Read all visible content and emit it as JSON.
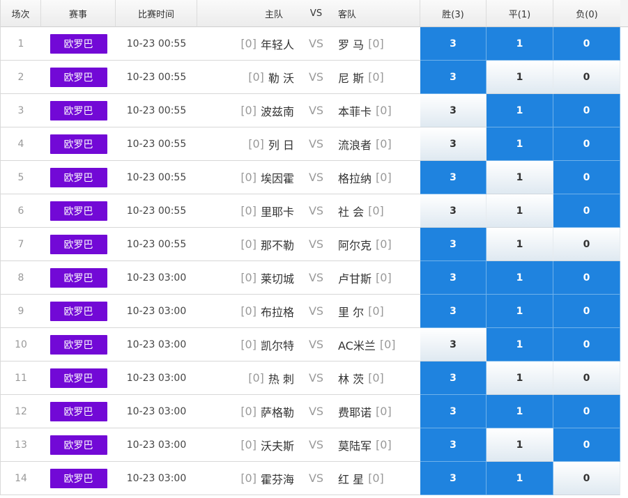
{
  "header": {
    "idx": "场次",
    "league": "赛事",
    "time": "比赛时间",
    "home": "主队",
    "vs": "VS",
    "away": "客队",
    "win": "胜(3)",
    "draw": "平(1)",
    "lose": "负(0)"
  },
  "colors": {
    "league_badge": "#7209d6",
    "selected": "#1f83df"
  },
  "matches": [
    {
      "idx": "1",
      "league": "欧罗巴",
      "time": "10-23 00:55",
      "home_rank": "[0]",
      "home": "年轻人",
      "vs": "VS",
      "away": "罗 马",
      "away_rank": "[0]",
      "win": "3",
      "draw": "1",
      "lose": "0",
      "sel_win": true,
      "sel_draw": true,
      "sel_lose": true
    },
    {
      "idx": "2",
      "league": "欧罗巴",
      "time": "10-23 00:55",
      "home_rank": "[0]",
      "home": "勒 沃",
      "vs": "VS",
      "away": "尼 斯",
      "away_rank": "[0]",
      "win": "3",
      "draw": "1",
      "lose": "0",
      "sel_win": true,
      "sel_draw": false,
      "sel_lose": false
    },
    {
      "idx": "3",
      "league": "欧罗巴",
      "time": "10-23 00:55",
      "home_rank": "[0]",
      "home": "波兹南",
      "vs": "VS",
      "away": "本菲卡",
      "away_rank": "[0]",
      "win": "3",
      "draw": "1",
      "lose": "0",
      "sel_win": false,
      "sel_draw": true,
      "sel_lose": true
    },
    {
      "idx": "4",
      "league": "欧罗巴",
      "time": "10-23 00:55",
      "home_rank": "[0]",
      "home": "列 日",
      "vs": "VS",
      "away": "流浪者",
      "away_rank": "[0]",
      "win": "3",
      "draw": "1",
      "lose": "0",
      "sel_win": false,
      "sel_draw": true,
      "sel_lose": true
    },
    {
      "idx": "5",
      "league": "欧罗巴",
      "time": "10-23 00:55",
      "home_rank": "[0]",
      "home": "埃因霍",
      "vs": "VS",
      "away": "格拉纳",
      "away_rank": "[0]",
      "win": "3",
      "draw": "1",
      "lose": "0",
      "sel_win": true,
      "sel_draw": false,
      "sel_lose": true
    },
    {
      "idx": "6",
      "league": "欧罗巴",
      "time": "10-23 00:55",
      "home_rank": "[0]",
      "home": "里耶卡",
      "vs": "VS",
      "away": "社 会",
      "away_rank": "[0]",
      "win": "3",
      "draw": "1",
      "lose": "0",
      "sel_win": false,
      "sel_draw": false,
      "sel_lose": true
    },
    {
      "idx": "7",
      "league": "欧罗巴",
      "time": "10-23 00:55",
      "home_rank": "[0]",
      "home": "那不勒",
      "vs": "VS",
      "away": "阿尔克",
      "away_rank": "[0]",
      "win": "3",
      "draw": "1",
      "lose": "0",
      "sel_win": true,
      "sel_draw": false,
      "sel_lose": false
    },
    {
      "idx": "8",
      "league": "欧罗巴",
      "time": "10-23 03:00",
      "home_rank": "[0]",
      "home": "莱切城",
      "vs": "VS",
      "away": "卢甘斯",
      "away_rank": "[0]",
      "win": "3",
      "draw": "1",
      "lose": "0",
      "sel_win": true,
      "sel_draw": true,
      "sel_lose": true
    },
    {
      "idx": "9",
      "league": "欧罗巴",
      "time": "10-23 03:00",
      "home_rank": "[0]",
      "home": "布拉格",
      "vs": "VS",
      "away": "里 尔",
      "away_rank": "[0]",
      "win": "3",
      "draw": "1",
      "lose": "0",
      "sel_win": true,
      "sel_draw": true,
      "sel_lose": true
    },
    {
      "idx": "10",
      "league": "欧罗巴",
      "time": "10-23 03:00",
      "home_rank": "[0]",
      "home": "凯尔特",
      "vs": "VS",
      "away": "AC米兰",
      "away_rank": "[0]",
      "win": "3",
      "draw": "1",
      "lose": "0",
      "sel_win": false,
      "sel_draw": true,
      "sel_lose": true
    },
    {
      "idx": "11",
      "league": "欧罗巴",
      "time": "10-23 03:00",
      "home_rank": "[0]",
      "home": "热 刺",
      "vs": "VS",
      "away": "林 茨",
      "away_rank": "[0]",
      "win": "3",
      "draw": "1",
      "lose": "0",
      "sel_win": true,
      "sel_draw": false,
      "sel_lose": false
    },
    {
      "idx": "12",
      "league": "欧罗巴",
      "time": "10-23 03:00",
      "home_rank": "[0]",
      "home": "萨格勒",
      "vs": "VS",
      "away": "费耶诺",
      "away_rank": "[0]",
      "win": "3",
      "draw": "1",
      "lose": "0",
      "sel_win": true,
      "sel_draw": true,
      "sel_lose": true
    },
    {
      "idx": "13",
      "league": "欧罗巴",
      "time": "10-23 03:00",
      "home_rank": "[0]",
      "home": "沃夫斯",
      "vs": "VS",
      "away": "莫陆军",
      "away_rank": "[0]",
      "win": "3",
      "draw": "1",
      "lose": "0",
      "sel_win": true,
      "sel_draw": false,
      "sel_lose": true
    },
    {
      "idx": "14",
      "league": "欧罗巴",
      "time": "10-23 03:00",
      "home_rank": "[0]",
      "home": "霍芬海",
      "vs": "VS",
      "away": "红 星",
      "away_rank": "[0]",
      "win": "3",
      "draw": "1",
      "lose": "0",
      "sel_win": true,
      "sel_draw": true,
      "sel_lose": false
    }
  ]
}
